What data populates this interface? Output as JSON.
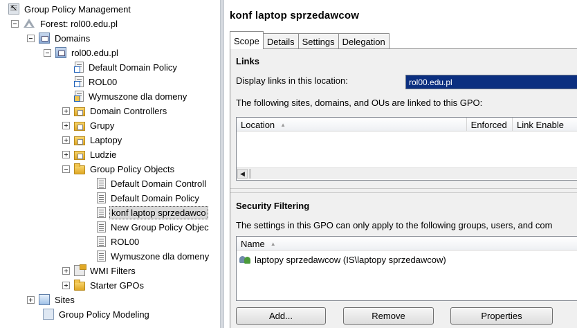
{
  "tree": {
    "root": "Group Policy Management",
    "forest": "Forest: rol00.edu.pl",
    "domains": "Domains",
    "domain": "rol00.edu.pl",
    "items": {
      "default_domain_policy": "Default Domain Policy",
      "rol00": "ROL00",
      "wymuszone": "Wymuszone dla domeny",
      "domain_controllers": "Domain Controllers",
      "grupy": "Grupy",
      "laptopy": "Laptopy",
      "ludzie": "Ludzie",
      "gpo_folder": "Group Policy Objects",
      "gpo_default_dc": "Default Domain Controll",
      "gpo_default_domain": "Default Domain Policy",
      "gpo_konf": "konf laptop sprzedawco",
      "gpo_new": "New Group Policy Objec",
      "gpo_rol00": "ROL00",
      "gpo_wymuszone": "Wymuszone dla domeny",
      "wmi": "WMI Filters",
      "starter": "Starter GPOs"
    },
    "sites": "Sites",
    "modeling": "Group Policy Modeling"
  },
  "details": {
    "title": "konf laptop sprzedawcow",
    "tabs": [
      "Scope",
      "Details",
      "Settings",
      "Delegation"
    ],
    "links": {
      "heading": "Links",
      "display_label": "Display links in this location:",
      "location_value": "rol00.edu.pl",
      "description": "The following sites, domains, and OUs are linked to this GPO:",
      "columns": [
        "Location",
        "Enforced",
        "Link Enable"
      ]
    },
    "security": {
      "heading": "Security Filtering",
      "description": "The settings in this GPO can only apply to the following groups, users, and com",
      "columns": [
        "Name"
      ],
      "rows": [
        "laptopy sprzedawcow (IS\\laptopy sprzedawcow)"
      ]
    },
    "buttons": {
      "add": "Add...",
      "remove": "Remove",
      "properties": "Properties"
    }
  },
  "colors": {
    "selection_dark": "#0b2f80",
    "tree_selection": "#d9d9d9",
    "pane_divider": "#d6dae0"
  }
}
